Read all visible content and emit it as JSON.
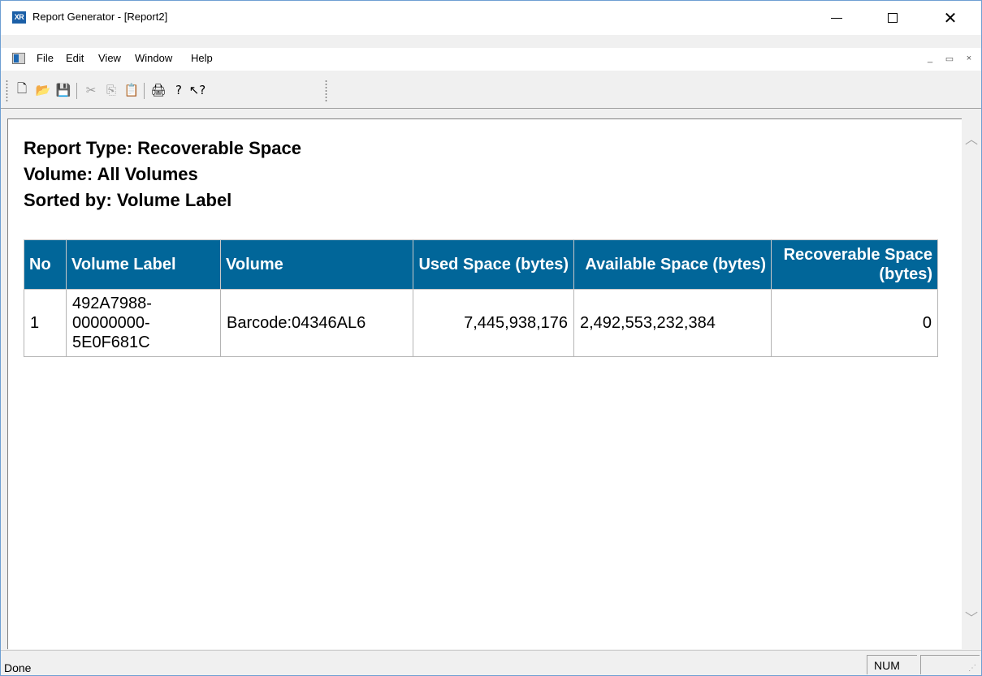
{
  "window": {
    "app_icon_text": "XR",
    "title": "Report Generator - [Report2]",
    "min_glyph": "—",
    "close_glyph": "✕"
  },
  "menu": {
    "items": [
      "File",
      "Edit",
      "View",
      "Window",
      "Help"
    ],
    "mdi_min": "_",
    "mdi_restore": "▭",
    "mdi_close": "×"
  },
  "toolbar": {
    "buttons": [
      {
        "name": "new-document-icon",
        "glyph": "🗋",
        "enabled": true
      },
      {
        "name": "open-folder-icon",
        "glyph": "📂",
        "enabled": true
      },
      {
        "name": "save-icon",
        "glyph": "💾",
        "enabled": true
      },
      {
        "name": "cut-icon",
        "glyph": "✂",
        "enabled": false
      },
      {
        "name": "copy-icon",
        "glyph": "⎘",
        "enabled": false
      },
      {
        "name": "paste-icon",
        "glyph": "📋",
        "enabled": false
      },
      {
        "name": "print-icon",
        "glyph": "🖨",
        "enabled": true
      },
      {
        "name": "help-icon",
        "glyph": "?",
        "enabled": true
      },
      {
        "name": "context-help-icon",
        "glyph": "↖?",
        "enabled": true
      }
    ]
  },
  "report": {
    "type_line": "Report Type: Recoverable Space",
    "volume_line": "Volume: All Volumes",
    "sorted_line": "Sorted by: Volume Label",
    "columns": [
      "No",
      "Volume Label",
      "Volume",
      "Used Space (bytes)",
      "Available Space (bytes)",
      "Recoverable Space (bytes)"
    ],
    "rows": [
      {
        "no": "1",
        "volume_label": "492A7988-\n00000000-\n5E0F681C",
        "volume": "Barcode:04346AL6",
        "used_space": "7,445,938,176",
        "available_space": "2,492,553,232,384",
        "recoverable_space": "0"
      }
    ]
  },
  "status": {
    "text": "Done",
    "num": "NUM"
  },
  "colors": {
    "header_bg": "#016699",
    "header_text": "#ffffff"
  }
}
